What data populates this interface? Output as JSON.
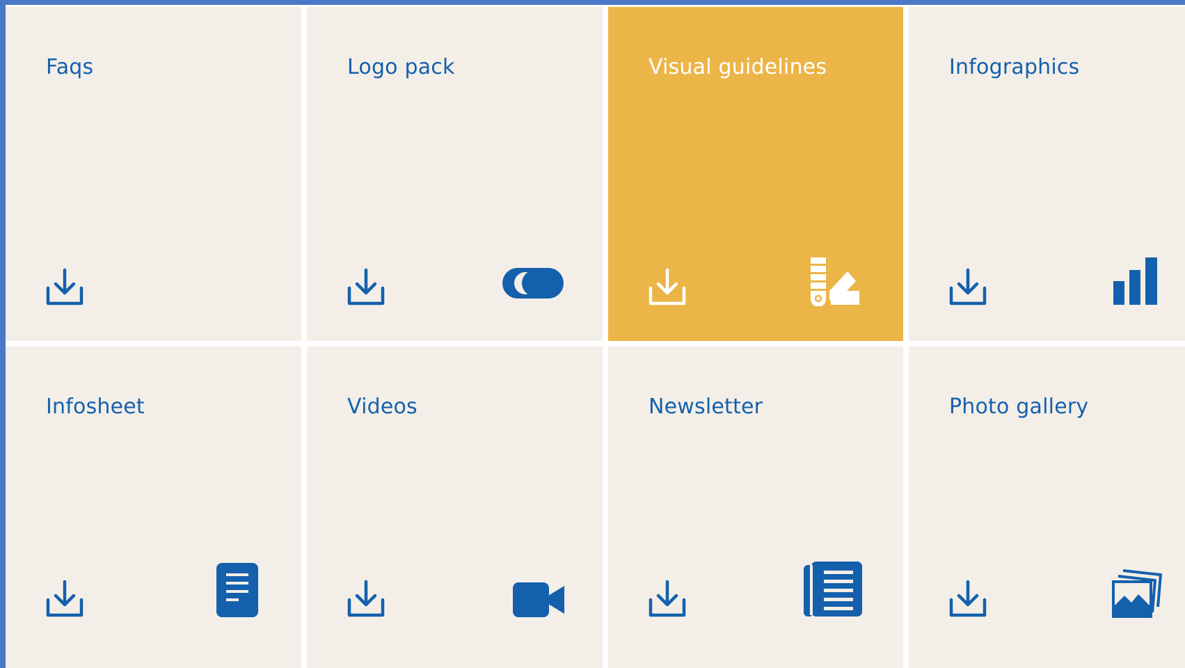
{
  "colors": {
    "tile_bg": "#f3efe8",
    "active_bg": "#ebb548",
    "brand_blue": "#1560ad",
    "frame_border": "#4a78c8"
  },
  "tiles": [
    {
      "label": "Faqs",
      "icon": "none",
      "active": false
    },
    {
      "label": "Logo pack",
      "icon": "toggle-logo-icon",
      "active": false
    },
    {
      "label": "Visual guidelines",
      "icon": "color-swatch-icon",
      "active": true
    },
    {
      "label": "Infographics",
      "icon": "bar-chart-icon",
      "active": false
    },
    {
      "label": "Infosheet",
      "icon": "document-icon",
      "active": false
    },
    {
      "label": "Videos",
      "icon": "video-camera-icon",
      "active": false
    },
    {
      "label": "Newsletter",
      "icon": "newspaper-icon",
      "active": false
    },
    {
      "label": "Photo gallery",
      "icon": "photo-gallery-icon",
      "active": false
    }
  ]
}
